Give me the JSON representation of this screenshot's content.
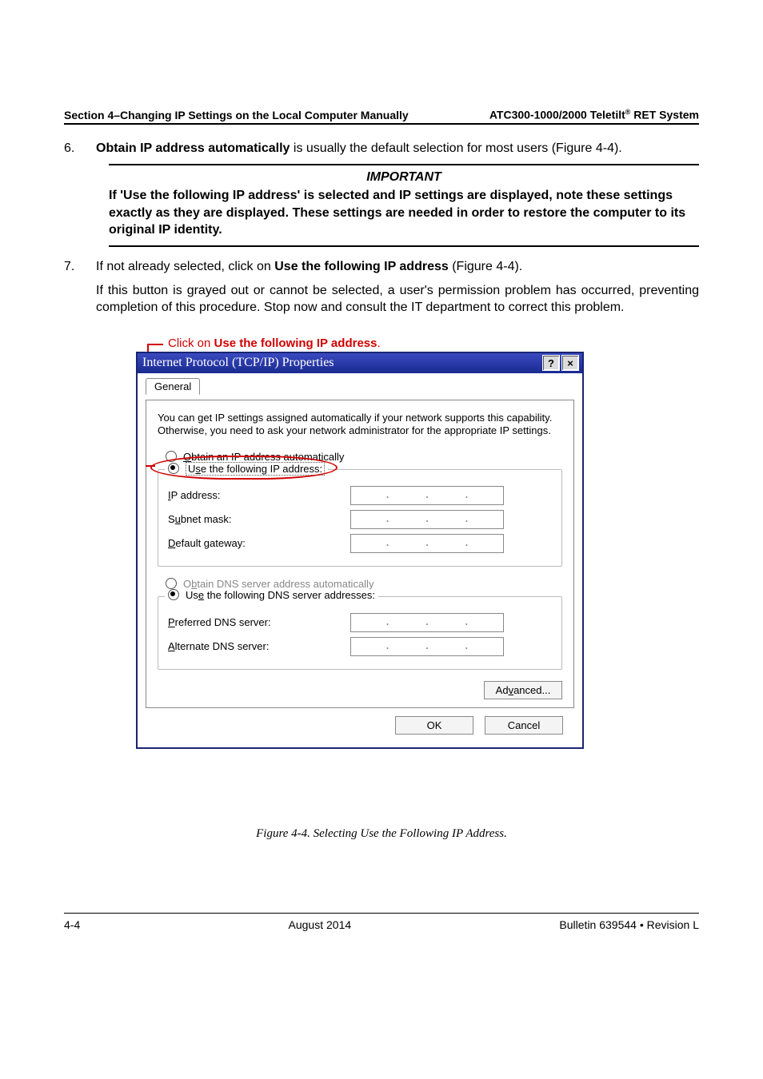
{
  "header": {
    "left": "Section 4–Changing IP Settings on the Local Computer Manually",
    "right_prefix": "ATC300-1000/2000 Teletilt",
    "right_suffix": " RET System"
  },
  "steps": {
    "s6": {
      "num": "6.",
      "bold": "Obtain IP address automatically",
      "rest": " is usually the default selection for most users (Figure 4-4)."
    },
    "important": {
      "label": "IMPORTANT",
      "text": "If 'Use the following IP address' is selected and IP settings are displayed, note these settings exactly as they are displayed. These settings are needed in order to restore the computer to its original IP identity."
    },
    "s7": {
      "num": "7.",
      "line1_a": "If not already selected, click on ",
      "line1_b": "Use the following IP address",
      "line1_c": " (Figure 4-4).",
      "para2": "If this button is grayed out or cannot be selected, a user's permission problem has occurred, preventing completion of this procedure. Stop now and consult the IT department to correct this problem."
    }
  },
  "callout": {
    "pre": "Click on ",
    "bold": "Use the following IP address",
    "post": "."
  },
  "dialog": {
    "title": "Internet Protocol (TCP/IP) Properties",
    "help": "?",
    "close": "×",
    "tab": "General",
    "intro": "You can get IP settings assigned automatically if your network supports this capability. Otherwise, you need to ask your network administrator for the appropriate IP settings.",
    "r_obtain_ip": "Obtain an IP address automatically",
    "r_use_ip": "Use the following IP address:",
    "f_ip": "IP address:",
    "f_subnet": "Subnet mask:",
    "f_gateway": "Default gateway:",
    "r_obtain_dns": "Obtain DNS server address automatically",
    "r_use_dns": "Use the following DNS server addresses:",
    "f_pdns": "Preferred DNS server:",
    "f_adns": "Alternate DNS server:",
    "btn_adv": "Advanced...",
    "btn_ok": "OK",
    "btn_cancel": "Cancel"
  },
  "figure": {
    "pre": "Figure 4-4.  Selecting ",
    "em": "Use the Following IP Address",
    "post": "."
  },
  "footer": {
    "left": "4-4",
    "center": "August 2014",
    "right": "Bulletin 639544  •  Revision L"
  }
}
